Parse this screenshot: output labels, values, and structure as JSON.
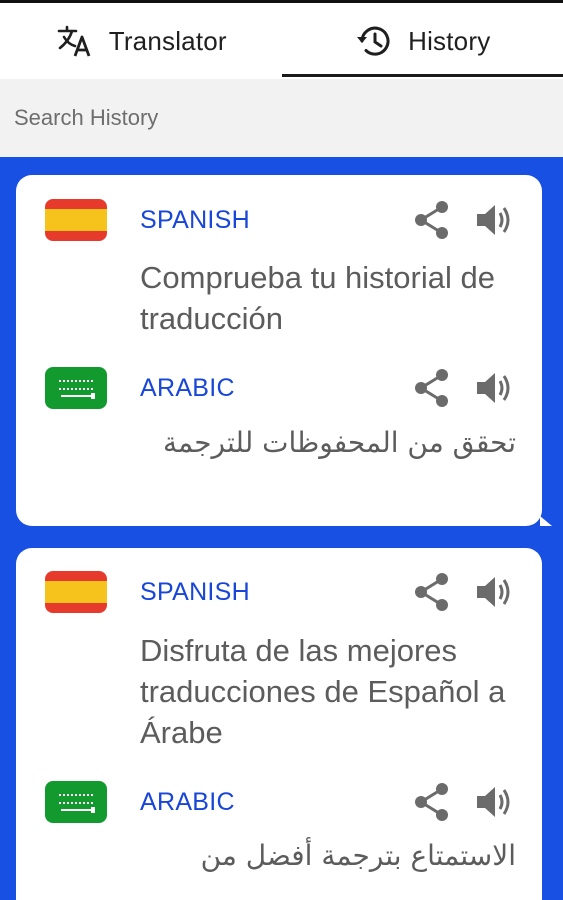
{
  "tabs": [
    {
      "label": "Translator",
      "icon": "translate-icon",
      "active": false
    },
    {
      "label": "History",
      "icon": "history-icon",
      "active": true
    }
  ],
  "search": {
    "placeholder": "Search History"
  },
  "colors": {
    "accent": "#1750e3",
    "language_label": "#1846d8",
    "text": "#5c5c5c",
    "card": "#ffffff"
  },
  "history": [
    {
      "source": {
        "language": "SPANISH",
        "flag": "spain-flag-icon",
        "text": "Comprueba tu historial de traducción"
      },
      "target": {
        "language": "ARABIC",
        "flag": "saudi-arabia-flag-icon",
        "text": "تحقق من المحفوظات للترجمة"
      }
    },
    {
      "source": {
        "language": "SPANISH",
        "flag": "spain-flag-icon",
        "text": "Disfruta de las mejores traducciones de Español a Árabe"
      },
      "target": {
        "language": "ARABIC",
        "flag": "saudi-arabia-flag-icon",
        "text": "الاستمتاع بترجمة أفضل من"
      }
    }
  ]
}
